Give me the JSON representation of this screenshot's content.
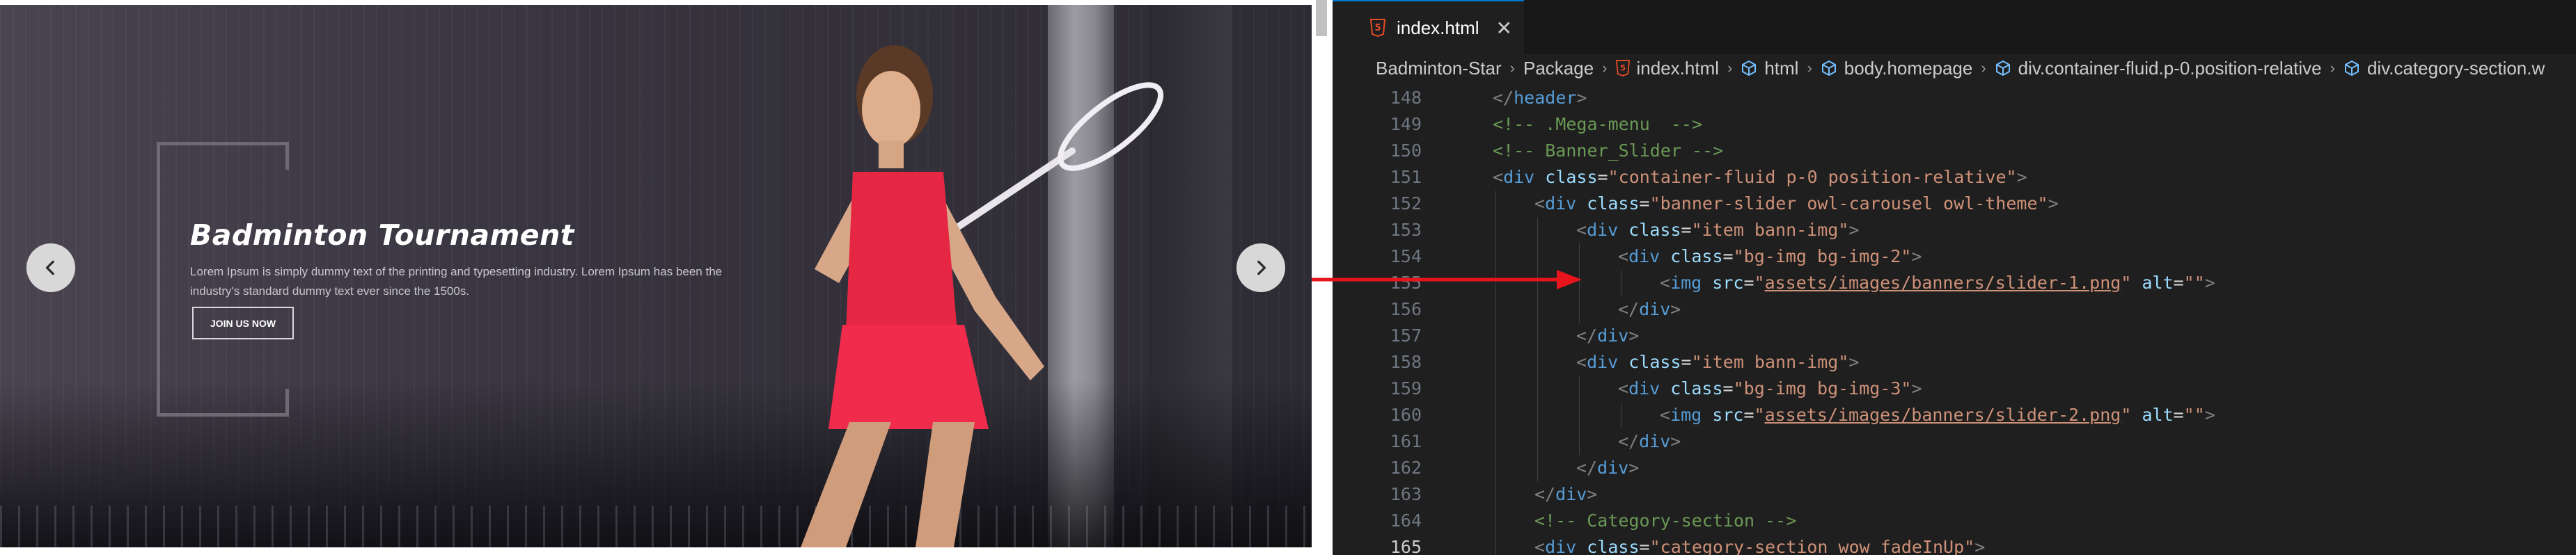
{
  "banner": {
    "title": "Badminton Tournament",
    "description": "Lorem Ipsum is simply dummy text of the printing and typesetting industry. Lorem Ipsum has been the industry's standard dummy text ever since the 1500s.",
    "button_label": "JOIN US NOW",
    "prev_icon": "chevron-left-icon",
    "next_icon": "chevron-right-icon"
  },
  "editor": {
    "tab": {
      "label": "index.html",
      "icon": "html5-file-icon",
      "close_icon": "close-icon"
    },
    "breadcrumb": [
      {
        "label": "Badminton-Star",
        "icon": ""
      },
      {
        "label": "Package",
        "icon": ""
      },
      {
        "label": "index.html",
        "icon": "html5-file-icon"
      },
      {
        "label": "html",
        "icon": "element-icon"
      },
      {
        "label": "body.homepage",
        "icon": "element-icon"
      },
      {
        "label": "div.container-fluid.p-0.position-relative",
        "icon": "element-icon"
      },
      {
        "label": "div.category-section.w",
        "icon": "element-icon"
      }
    ],
    "current_line": 165,
    "lines": [
      {
        "num": "148",
        "indent": 1,
        "tokens": [
          [
            "punct",
            "</"
          ],
          [
            "tag",
            "header"
          ],
          [
            "punct",
            ">"
          ]
        ]
      },
      {
        "num": "149",
        "indent": 1,
        "tokens": [
          [
            "comment",
            "<!-- .Mega-menu  -->"
          ]
        ]
      },
      {
        "num": "150",
        "indent": 1,
        "tokens": [
          [
            "comment",
            "<!-- Banner_Slider -->"
          ]
        ]
      },
      {
        "num": "151",
        "indent": 1,
        "tokens": [
          [
            "punct",
            "<"
          ],
          [
            "tag",
            "div"
          ],
          [
            "plain",
            " "
          ],
          [
            "attr",
            "class"
          ],
          [
            "plain",
            "="
          ],
          [
            "str",
            "\"container-fluid p-0 position-relative\""
          ],
          [
            "punct",
            ">"
          ]
        ]
      },
      {
        "num": "152",
        "indent": 2,
        "tokens": [
          [
            "punct",
            "<"
          ],
          [
            "tag",
            "div"
          ],
          [
            "plain",
            " "
          ],
          [
            "attr",
            "class"
          ],
          [
            "plain",
            "="
          ],
          [
            "str",
            "\"banner-slider owl-carousel owl-theme\""
          ],
          [
            "punct",
            ">"
          ]
        ]
      },
      {
        "num": "153",
        "indent": 3,
        "tokens": [
          [
            "punct",
            "<"
          ],
          [
            "tag",
            "div"
          ],
          [
            "plain",
            " "
          ],
          [
            "attr",
            "class"
          ],
          [
            "plain",
            "="
          ],
          [
            "str",
            "\"item bann-img\""
          ],
          [
            "punct",
            ">"
          ]
        ]
      },
      {
        "num": "154",
        "indent": 4,
        "tokens": [
          [
            "punct",
            "<"
          ],
          [
            "tag",
            "div"
          ],
          [
            "plain",
            " "
          ],
          [
            "attr",
            "class"
          ],
          [
            "plain",
            "="
          ],
          [
            "str",
            "\"bg-img bg-img-2\""
          ],
          [
            "punct",
            ">"
          ]
        ]
      },
      {
        "num": "155",
        "indent": 5,
        "tokens": [
          [
            "punct",
            "<"
          ],
          [
            "tag",
            "img"
          ],
          [
            "plain",
            " "
          ],
          [
            "attr",
            "src"
          ],
          [
            "plain",
            "="
          ],
          [
            "str",
            "\""
          ],
          [
            "link",
            "assets/images/banners/slider-1.png"
          ],
          [
            "str",
            "\""
          ],
          [
            "plain",
            " "
          ],
          [
            "attr",
            "alt"
          ],
          [
            "plain",
            "="
          ],
          [
            "str",
            "\"\""
          ],
          [
            "punct",
            ">"
          ]
        ]
      },
      {
        "num": "156",
        "indent": 4,
        "tokens": [
          [
            "punct",
            "</"
          ],
          [
            "tag",
            "div"
          ],
          [
            "punct",
            ">"
          ]
        ]
      },
      {
        "num": "157",
        "indent": 3,
        "tokens": [
          [
            "punct",
            "</"
          ],
          [
            "tag",
            "div"
          ],
          [
            "punct",
            ">"
          ]
        ]
      },
      {
        "num": "158",
        "indent": 3,
        "tokens": [
          [
            "punct",
            "<"
          ],
          [
            "tag",
            "div"
          ],
          [
            "plain",
            " "
          ],
          [
            "attr",
            "class"
          ],
          [
            "plain",
            "="
          ],
          [
            "str",
            "\"item bann-img\""
          ],
          [
            "punct",
            ">"
          ]
        ]
      },
      {
        "num": "159",
        "indent": 4,
        "tokens": [
          [
            "punct",
            "<"
          ],
          [
            "tag",
            "div"
          ],
          [
            "plain",
            " "
          ],
          [
            "attr",
            "class"
          ],
          [
            "plain",
            "="
          ],
          [
            "str",
            "\"bg-img bg-img-3\""
          ],
          [
            "punct",
            ">"
          ]
        ]
      },
      {
        "num": "160",
        "indent": 5,
        "tokens": [
          [
            "punct",
            "<"
          ],
          [
            "tag",
            "img"
          ],
          [
            "plain",
            " "
          ],
          [
            "attr",
            "src"
          ],
          [
            "plain",
            "="
          ],
          [
            "str",
            "\""
          ],
          [
            "link",
            "assets/images/banners/slider-2.png"
          ],
          [
            "str",
            "\""
          ],
          [
            "plain",
            " "
          ],
          [
            "attr",
            "alt"
          ],
          [
            "plain",
            "="
          ],
          [
            "str",
            "\"\""
          ],
          [
            "punct",
            ">"
          ]
        ]
      },
      {
        "num": "161",
        "indent": 4,
        "tokens": [
          [
            "punct",
            "</"
          ],
          [
            "tag",
            "div"
          ],
          [
            "punct",
            ">"
          ]
        ]
      },
      {
        "num": "162",
        "indent": 3,
        "tokens": [
          [
            "punct",
            "</"
          ],
          [
            "tag",
            "div"
          ],
          [
            "punct",
            ">"
          ]
        ]
      },
      {
        "num": "163",
        "indent": 2,
        "tokens": [
          [
            "punct",
            "</"
          ],
          [
            "tag",
            "div"
          ],
          [
            "punct",
            ">"
          ]
        ]
      },
      {
        "num": "164",
        "indent": 2,
        "tokens": [
          [
            "comment",
            "<!-- Category-section -->"
          ]
        ]
      },
      {
        "num": "165",
        "indent": 2,
        "tokens": [
          [
            "punct",
            "<"
          ],
          [
            "tag",
            "div"
          ],
          [
            "plain",
            " "
          ],
          [
            "attr",
            "class"
          ],
          [
            "plain",
            "="
          ],
          [
            "str",
            "\"category-section wow fadeInUp\""
          ],
          [
            "punct",
            ">"
          ]
        ]
      }
    ]
  },
  "colors": {
    "arrow": "#e8141b",
    "tab_accent": "#0078d4",
    "html5": "#e44d26",
    "element_icon": "#75beff"
  }
}
